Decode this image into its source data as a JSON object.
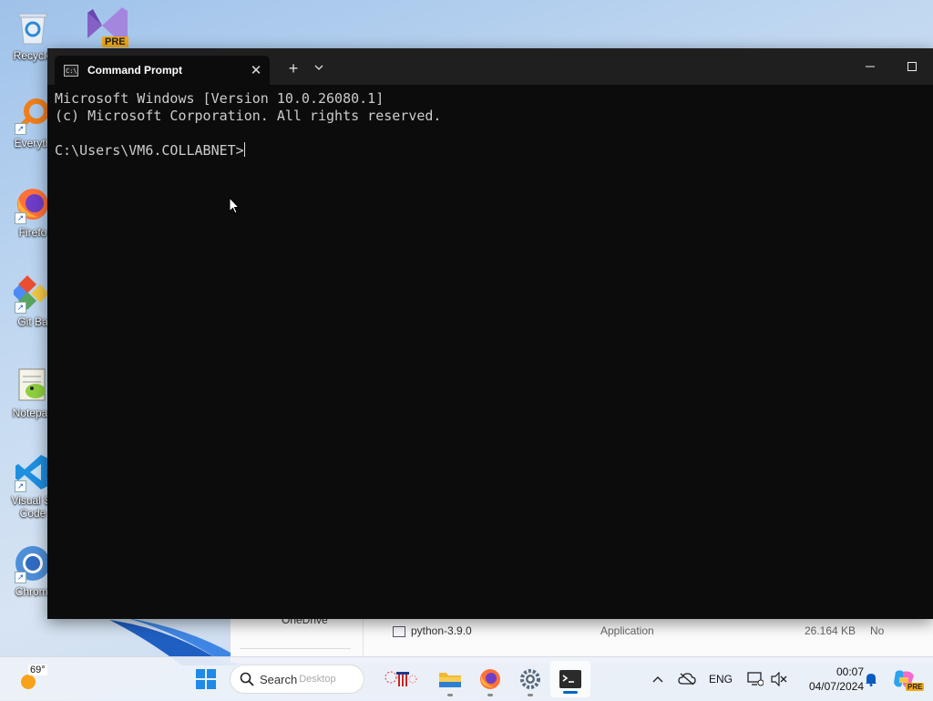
{
  "desktop": {
    "icons": [
      {
        "label": "Recycle",
        "icon": "recycle-bin-icon"
      },
      {
        "label": "Everyth",
        "icon": "everything-search-icon"
      },
      {
        "label": "Firefo",
        "icon": "firefox-icon"
      },
      {
        "label": "Git Ba",
        "icon": "git-bash-icon"
      },
      {
        "label": "Notepac",
        "icon": "notepad-plus-plus-icon"
      },
      {
        "label": "Visual St",
        "label2": "Code",
        "icon": "vscode-icon"
      },
      {
        "label": "Chromi",
        "icon": "chromium-icon"
      }
    ],
    "vs_badge": "PRE"
  },
  "terminal": {
    "tab_title": "Command Prompt",
    "lines": [
      "Microsoft Windows [Version 10.0.26080.1]",
      "(c) Microsoft Corporation. All rights reserved.",
      "",
      "C:\\Users\\VM6.COLLABNET>"
    ]
  },
  "background_window": {
    "nav_item": "OneDrive",
    "file_name": "python-3.9.0",
    "file_type": "Application",
    "file_size": "26.164 KB",
    "extra": "No"
  },
  "taskbar": {
    "weather_temp": "69°",
    "search_placeholder": "Search",
    "search_ghost": "Desktop",
    "language": "ENG",
    "time": "00:07",
    "date": "04/07/2024",
    "copilot_badge": "PRE"
  },
  "colors": {
    "terminal_bg": "#0c0c0c",
    "titlebar_bg": "#1f1f1f",
    "accent": "#0067c0"
  }
}
